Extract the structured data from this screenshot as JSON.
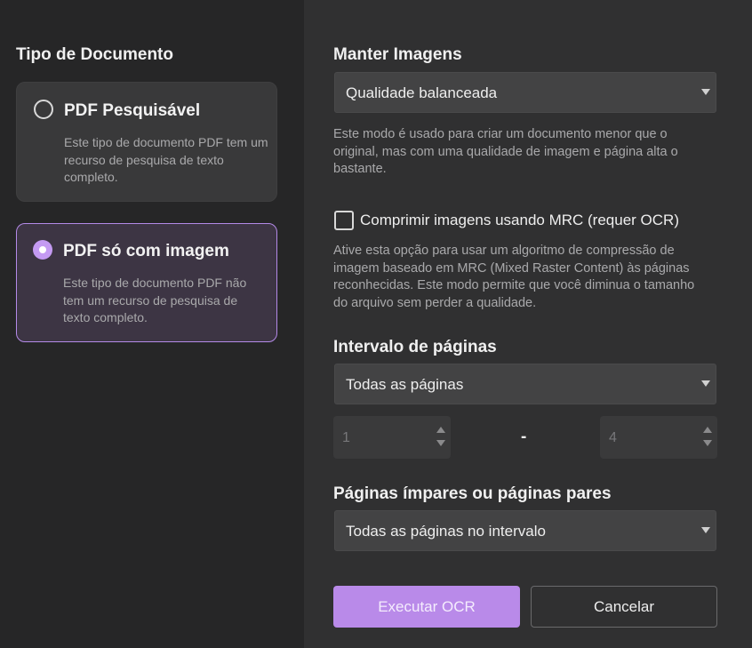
{
  "document_type": {
    "title": "Tipo de Documento",
    "options": [
      {
        "title": "PDF Pesquisável",
        "description": "Este tipo de documento PDF tem um recurso de pesquisa de texto completo.",
        "selected": false
      },
      {
        "title": "PDF só com imagem",
        "description": "Este tipo de documento PDF não tem um recurso de pesquisa de texto completo.",
        "selected": true
      }
    ]
  },
  "keep_images": {
    "title": "Manter Imagens",
    "selected": "Qualidade balanceada",
    "description": "Este modo é usado para criar um documento menor que o original, mas com uma qualidade de imagem e página alta o bastante."
  },
  "mrc": {
    "label": "Comprimir imagens usando MRC (requer OCR)",
    "checked": false,
    "description": "Ative esta opção para usar um algoritmo de compressão de imagem baseado em MRC (Mixed Raster Content) às páginas reconhecidas. Este modo permite que você diminua o tamanho do arquivo sem perder a qualidade."
  },
  "page_range": {
    "title": "Intervalo de páginas",
    "selected": "Todas as páginas",
    "from": "1",
    "separator": "-",
    "to": "4"
  },
  "odd_even": {
    "title": "Páginas ímpares ou páginas pares",
    "selected": "Todas as páginas no intervalo"
  },
  "actions": {
    "run": "Executar OCR",
    "cancel": "Cancelar"
  },
  "colors": {
    "accent": "#b98ae9",
    "selected_card_bg": "#3d3544"
  }
}
